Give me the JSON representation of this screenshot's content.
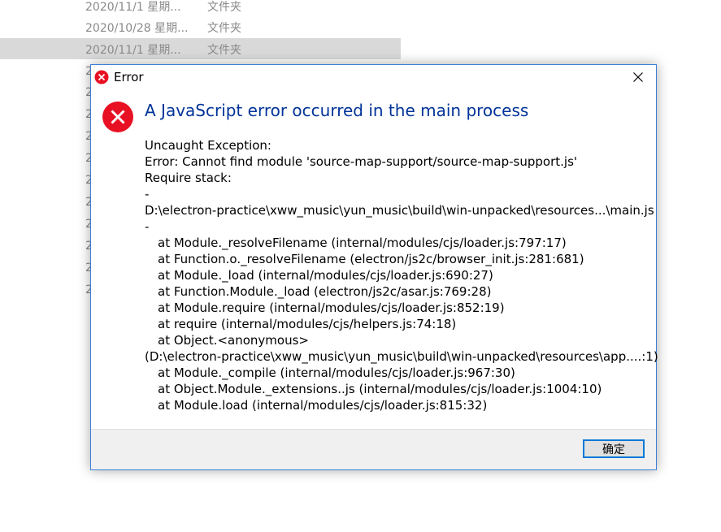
{
  "background": {
    "rows": [
      {
        "date": "2020/11/1 星期...",
        "type": "文件夹"
      },
      {
        "date": "2020/10/28 星期...",
        "type": "文件夹"
      },
      {
        "date": "2020/11/1 星期...",
        "type": "文件夹"
      }
    ],
    "row_fragment": "2"
  },
  "dialog": {
    "title": "Error",
    "main_instruction": "A JavaScript error occurred in the main process",
    "lines": [
      "Uncaught Exception:",
      "Error: Cannot find module 'source-map-support/source-map-support.js'",
      "Require stack:",
      "-",
      "D:\\electron-practice\\xww_music\\yun_music\\build\\win-unpacked\\resources...\\main.js",
      "-",
      "at Module._resolveFilename (internal/modules/cjs/loader.js:797:17)",
      "at Function.o._resolveFilename (electron/js2c/browser_init.js:281:681)",
      "at Module._load (internal/modules/cjs/loader.js:690:27)",
      "at Function.Module._load (electron/js2c/asar.js:769:28)",
      "at Module.require (internal/modules/cjs/loader.js:852:19)",
      "at require (internal/modules/cjs/helpers.js:74:18)",
      "at Object.<anonymous>",
      "(D:\\electron-practice\\xww_music\\yun_music\\build\\win-unpacked\\resources\\app....:1)",
      "at Module._compile (internal/modules/cjs/loader.js:967:30)",
      "at Object.Module._extensions..js (internal/modules/cjs/loader.js:1004:10)",
      "at Module.load (internal/modules/cjs/loader.js:815:32)"
    ],
    "ok_label": "确定",
    "icons": {
      "title": "error-icon",
      "main": "error-icon",
      "close": "close-icon"
    },
    "colors": {
      "error_red": "#e81123",
      "instruction_blue": "#003399",
      "accent": "#0078d7"
    }
  }
}
